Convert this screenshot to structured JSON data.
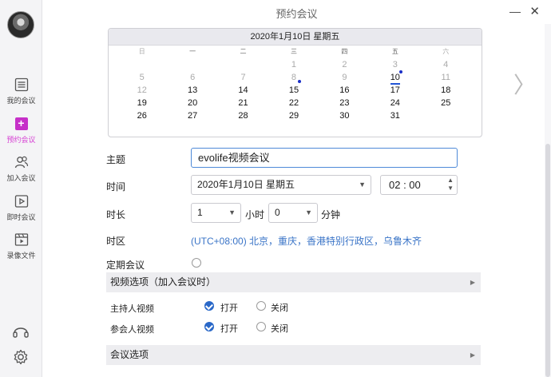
{
  "window": {
    "title": "预约会议",
    "minimize": "—",
    "close": "✕"
  },
  "sidebar": {
    "items": [
      {
        "label": "我的会议",
        "icon": "list-icon"
      },
      {
        "label": "预约会议",
        "icon": "plus-icon",
        "active": true
      },
      {
        "label": "加入会议",
        "icon": "users-icon"
      },
      {
        "label": "即时会议",
        "icon": "video-icon"
      },
      {
        "label": "录像文件",
        "icon": "film-icon"
      }
    ],
    "bottom_icons": [
      "headset-icon",
      "gear-icon"
    ]
  },
  "calendar": {
    "header": "2020年1月10日 星期五",
    "weekdays": [
      "日",
      "一",
      "二",
      "三",
      "四",
      "五",
      "六"
    ],
    "weeks": [
      [
        "",
        "",
        "",
        "1",
        "2",
        "3",
        "4"
      ],
      [
        "5",
        "6",
        "7",
        "8",
        "9",
        "10",
        "11"
      ],
      [
        "12",
        "13",
        "14",
        "15",
        "16",
        "17",
        "18"
      ],
      [
        "19",
        "20",
        "21",
        "22",
        "23",
        "24",
        "25"
      ],
      [
        "26",
        "27",
        "28",
        "29",
        "30",
        "31",
        ""
      ]
    ],
    "selected": "10",
    "marked_days": [
      "8",
      "10"
    ],
    "selectable_from": "13",
    "selectable_to": "31"
  },
  "form": {
    "topic_label": "主题",
    "topic_value": "evolife视频会议",
    "time_label": "时间",
    "date_value": "2020年1月10日 星期五",
    "time_value": "02 : 00",
    "duration_label": "时长",
    "hours_value": "1",
    "hours_unit": "小时",
    "minutes_value": "0",
    "minutes_unit": "分钟",
    "timezone_label": "时区",
    "timezone_value": "(UTC+08:00) 北京，重庆，香港特别行政区，乌鲁木齐",
    "recurring_label": "定期会议"
  },
  "video_options": {
    "header": "视频选项（加入会议时）",
    "host_label": "主持人视频",
    "participant_label": "参会人视频",
    "on_label": "打开",
    "off_label": "关闭",
    "host_on": true,
    "participant_on": true
  },
  "meeting_options": {
    "header": "会议选项"
  },
  "colors": {
    "accent": "#c630c8",
    "link": "#3a74c7",
    "check": "#2a68c8"
  }
}
